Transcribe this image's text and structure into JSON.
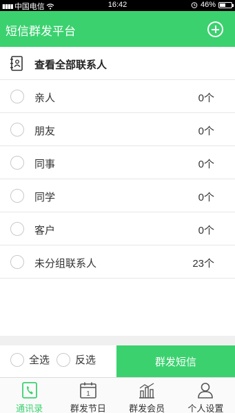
{
  "status_bar": {
    "carrier": "中国电信",
    "time": "16:42",
    "battery_text": "46%",
    "battery_level": 0.46
  },
  "app_bar": {
    "title": "短信群发平台",
    "add_icon": "plus-circle-icon"
  },
  "view_all": {
    "label": "查看全部联系人",
    "icon": "contacts-book-icon"
  },
  "groups": [
    {
      "name": "亲人",
      "count": "0个"
    },
    {
      "name": "朋友",
      "count": "0个"
    },
    {
      "name": "同事",
      "count": "0个"
    },
    {
      "name": "同学",
      "count": "0个"
    },
    {
      "name": "客户",
      "count": "0个"
    },
    {
      "name": "未分组联系人",
      "count": "23个"
    }
  ],
  "actions": {
    "select_all": "全选",
    "invert": "反选",
    "send": "群发短信"
  },
  "tabs": [
    {
      "label": "通讯录",
      "icon": "phone-book-icon",
      "active": true
    },
    {
      "label": "群发节日",
      "icon": "calendar-icon",
      "active": false
    },
    {
      "label": "群发会员",
      "icon": "members-chart-icon",
      "active": false
    },
    {
      "label": "个人设置",
      "icon": "person-icon",
      "active": false
    }
  ],
  "colors": {
    "brand_green": "#3bd16f",
    "status_bar": "#000000",
    "divider": "#e6e6e6"
  }
}
